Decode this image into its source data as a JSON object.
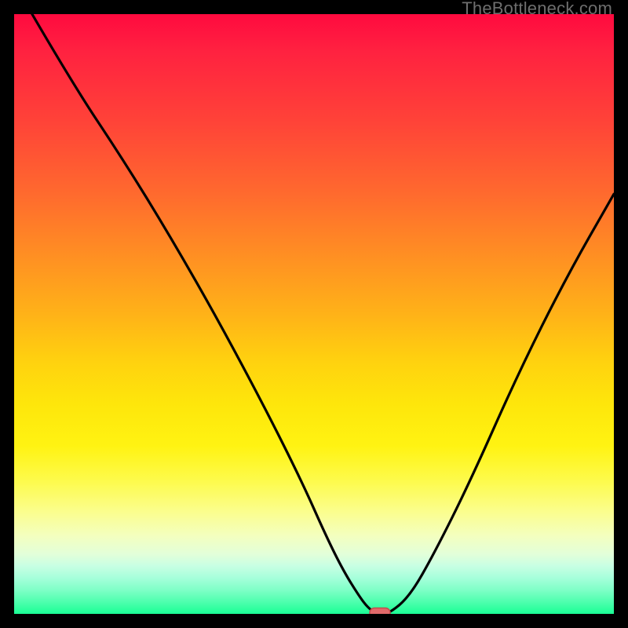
{
  "watermark": {
    "text": "TheBottleneck.com"
  },
  "colors": {
    "frame": "#000000",
    "curve": "#000000",
    "marker_fill": "#e26a6a",
    "marker_stroke": "#c24d4d",
    "gradient_stops": [
      "#ff0a3f",
      "#ff2140",
      "#ff4338",
      "#ff6a2e",
      "#ff8e23",
      "#ffb218",
      "#ffd20f",
      "#fee60b",
      "#fff312",
      "#fdfb4e",
      "#fbfe8e",
      "#f3ffbf",
      "#e3ffd9",
      "#c8ffe3",
      "#a6ffdb",
      "#7fffc7",
      "#4effae",
      "#1aff95"
    ]
  },
  "chart_data": {
    "type": "line",
    "title": "",
    "xlabel": "",
    "ylabel": "",
    "xlim": [
      0,
      100
    ],
    "ylim": [
      0,
      100
    ],
    "grid": false,
    "legend": false,
    "series": [
      {
        "name": "bottleneck-curve",
        "x": [
          3,
          10,
          18,
          26,
          34,
          42,
          48,
          52,
          55,
          57.5,
          59,
          60.5,
          62.5,
          66,
          70,
          76,
          84,
          92,
          100
        ],
        "y": [
          100,
          88,
          76,
          63,
          49,
          34,
          22,
          13,
          7,
          3,
          1,
          0,
          0,
          3,
          10,
          22,
          40,
          56,
          70
        ]
      }
    ],
    "flat_segment": {
      "x_start": 59,
      "x_end": 63,
      "y": 0
    },
    "marker": {
      "x": 61,
      "y": 0,
      "shape": "pill"
    }
  }
}
